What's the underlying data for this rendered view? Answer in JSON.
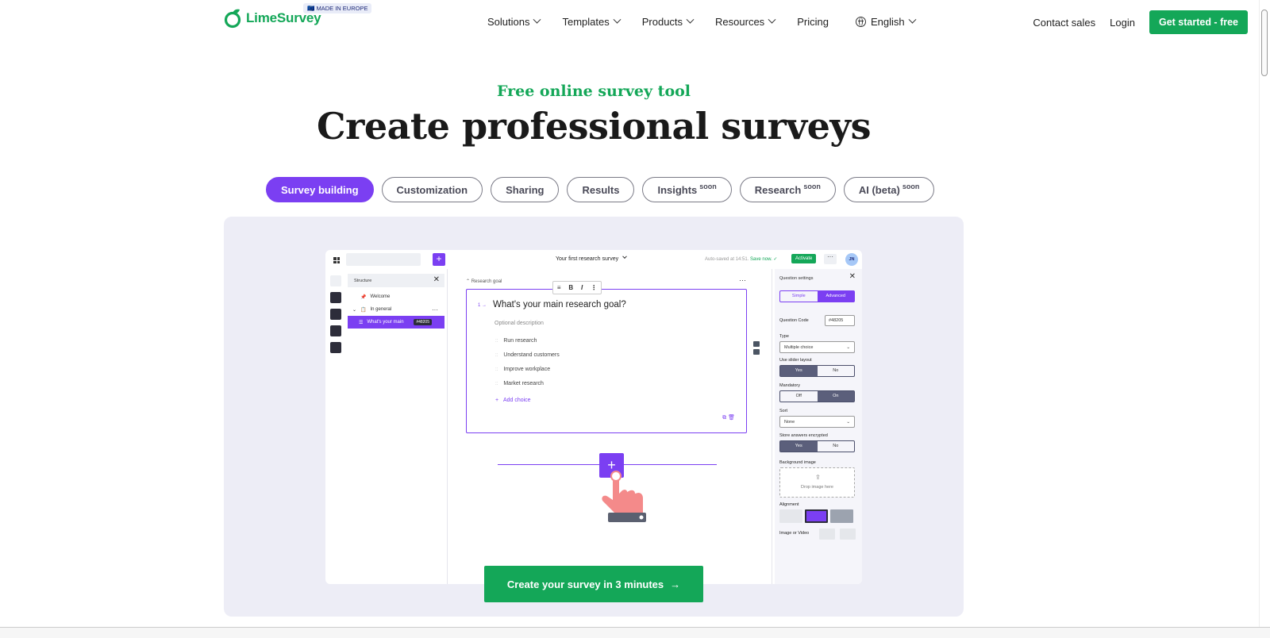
{
  "header": {
    "logo_text": "LimeSurvey",
    "badge": "MADE IN EUROPE",
    "nav": [
      "Solutions",
      "Templates",
      "Products",
      "Resources",
      "Pricing"
    ],
    "language": "English",
    "contact": "Contact sales",
    "login": "Login",
    "cta": "Get started - free"
  },
  "hero": {
    "subtitle": "Free online survey tool",
    "title": "Create professional surveys"
  },
  "tabs": [
    {
      "label": "Survey building",
      "soon": ""
    },
    {
      "label": "Customization",
      "soon": ""
    },
    {
      "label": "Sharing",
      "soon": ""
    },
    {
      "label": "Results",
      "soon": ""
    },
    {
      "label": "Insights",
      "soon": "soon"
    },
    {
      "label": "Research",
      "soon": "soon"
    },
    {
      "label": "AI (beta)",
      "soon": "soon"
    }
  ],
  "app": {
    "survey_title": "Your first research survey",
    "autosave": "Auto-saved at 14:51.",
    "save_now": "Save now.",
    "activate": "Activate",
    "avatar": "JN",
    "structure": {
      "title": "Structure",
      "welcome": "Welcome",
      "group": "In general",
      "question": "What's your main",
      "question_code": "#48205"
    },
    "group_label": "Research goal",
    "question": {
      "number": "1 →",
      "text": "What's your main research goal?",
      "description": "Optional description",
      "choices": [
        "Run research",
        "Understand customers",
        "Improve workplace",
        "Market research"
      ],
      "add_choice": "Add choice"
    },
    "settings": {
      "title": "Question settings",
      "simple": "Simple",
      "advanced": "Advanced",
      "code_label": "Question Code",
      "code_value": "#48205",
      "type_label": "Type",
      "type_value": "Multiple choice",
      "slider_label": "Use slider layout",
      "yes": "Yes",
      "no": "No",
      "mandatory_label": "Mandatory",
      "off": "Off",
      "on": "On",
      "sort_label": "Sort",
      "sort_value": "None",
      "encrypted_label": "Store answers encrypted",
      "bg_label": "Background image",
      "drop": "Drop image here",
      "alignment_label": "Alignment",
      "media_label": "Image or Video"
    }
  },
  "cta": "Create your survey in 3 minutes"
}
